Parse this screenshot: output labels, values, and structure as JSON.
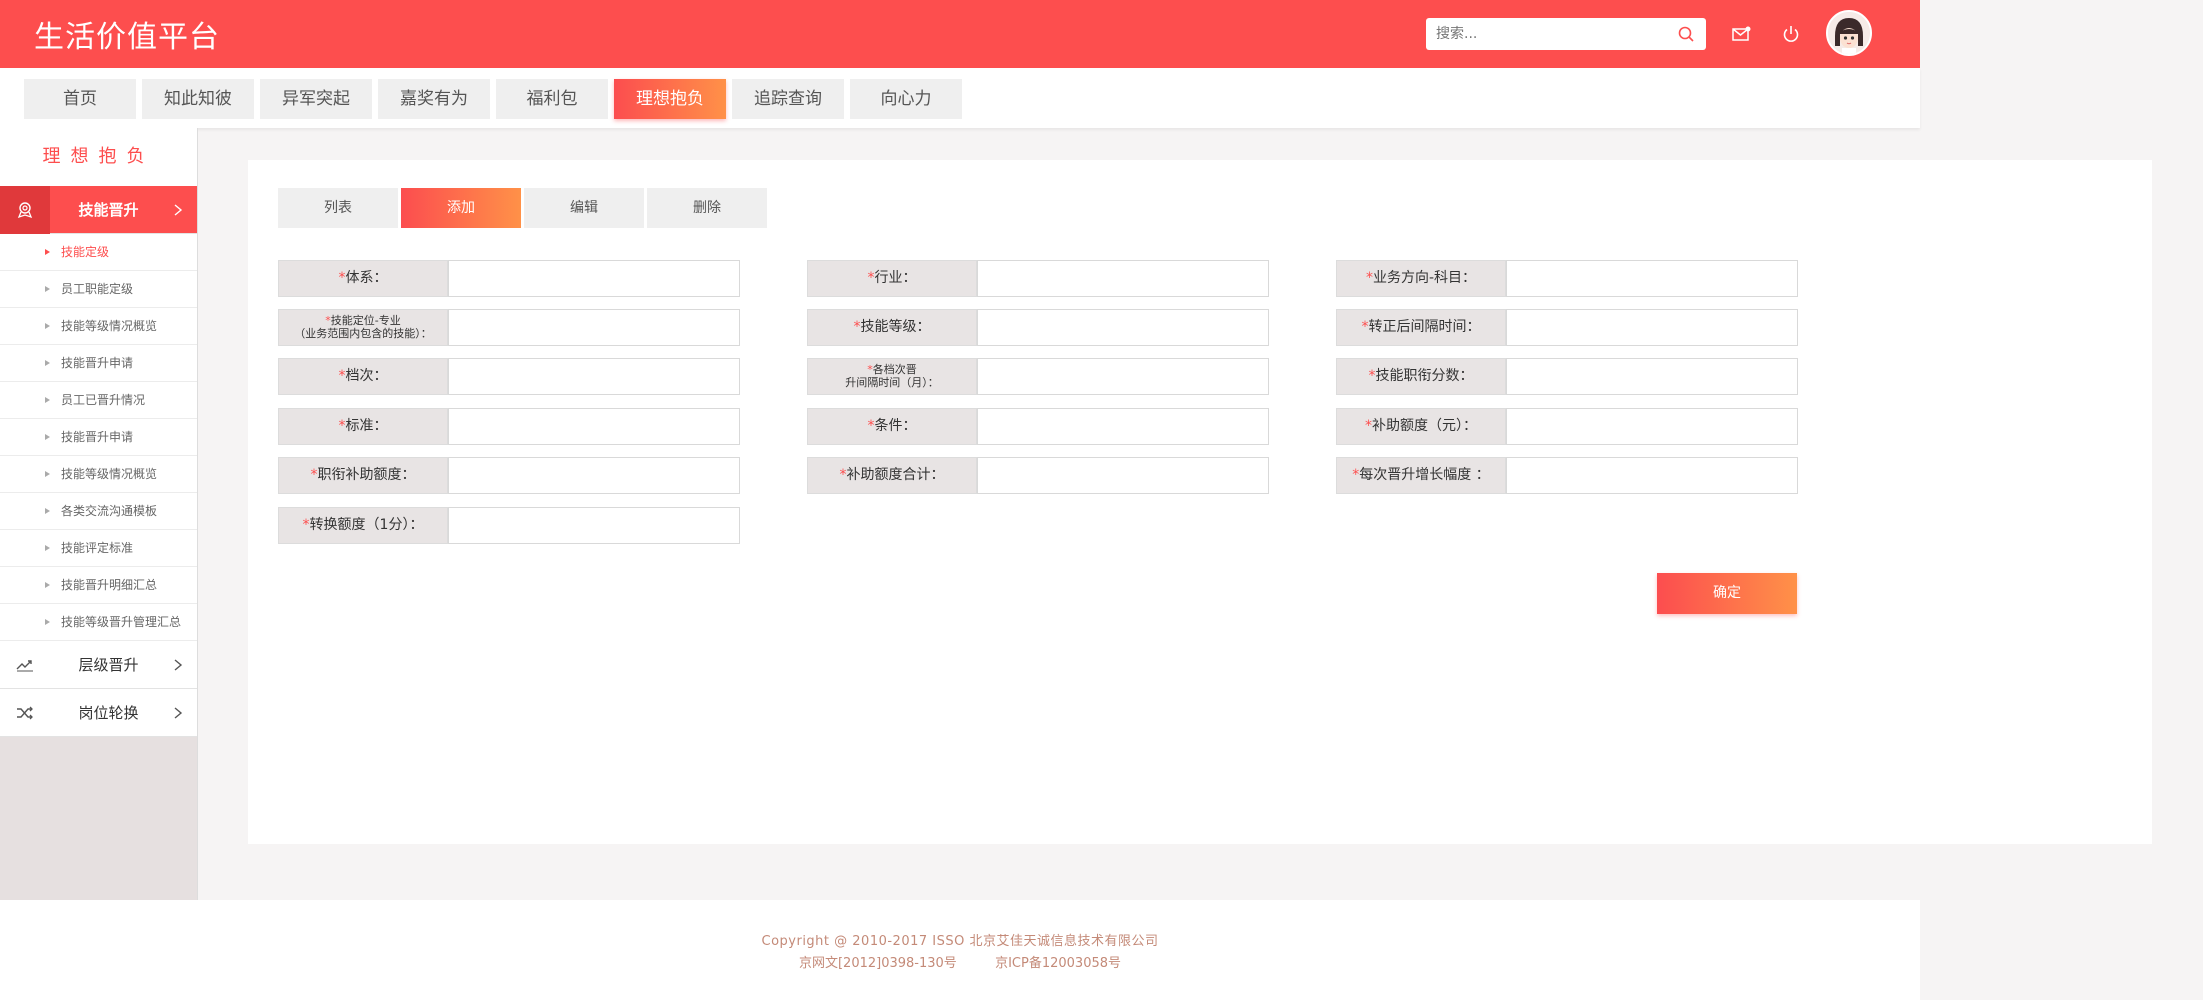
{
  "header": {
    "logo": "生活价值平台",
    "search_placeholder": "搜索..."
  },
  "nav": [
    {
      "label": "首页"
    },
    {
      "label": "知此知彼"
    },
    {
      "label": "异军突起"
    },
    {
      "label": "嘉奖有为"
    },
    {
      "label": "福利包"
    },
    {
      "label": "理想抱负",
      "active": true
    },
    {
      "label": "追踪查询"
    },
    {
      "label": "向心力"
    }
  ],
  "sidebar": {
    "title": "理想抱负",
    "groups": [
      {
        "label": "技能晋升",
        "active": true,
        "icon": "badge-icon"
      },
      {
        "label": "层级晋升",
        "icon": "trend-icon"
      },
      {
        "label": "岗位轮换",
        "icon": "shuffle-icon"
      }
    ],
    "sub_items": [
      "技能定级",
      "员工职能定级",
      "技能等级情况概览",
      "技能晋升申请",
      "员工已晋升情况",
      "技能晋升申请",
      "技能等级情况概览",
      "各类交流沟通模板",
      "技能评定标准",
      "技能晋升明细汇总",
      "技能等级晋升管理汇总"
    ]
  },
  "tabs": [
    "列表",
    "添加",
    "编辑",
    "删除"
  ],
  "form": {
    "fields": [
      {
        "label": "体系："
      },
      {
        "label": "行业："
      },
      {
        "label": "业务方向-科目："
      },
      {
        "label": "技能定位-专业",
        "label2": "（业务范围内包含的技能）："
      },
      {
        "label": "技能等级："
      },
      {
        "label": "转正后间隔时间："
      },
      {
        "label": "档次："
      },
      {
        "label": "各档次晋",
        "label2": "升间隔时间（月）："
      },
      {
        "label": "技能职衔分数："
      },
      {
        "label": "标准："
      },
      {
        "label": "条件："
      },
      {
        "label": "补助额度（元）："
      },
      {
        "label": "职衔补助额度："
      },
      {
        "label": "补助额度合计："
      },
      {
        "label": "每次晋升增长幅度 ："
      },
      {
        "label": "转换额度（1分）："
      }
    ],
    "required_mark": "*",
    "confirm": "确定"
  },
  "footer": {
    "line1": "Copyright @ 2010-2017 ISSO 北京艾佳天诚信息技术有限公司",
    "icp1": "京网文[2012]0398-130号",
    "icp2": "京ICP备12003058号"
  },
  "colors": {
    "brand": "#fd4e4e",
    "gradient_end": "#ff9148"
  }
}
